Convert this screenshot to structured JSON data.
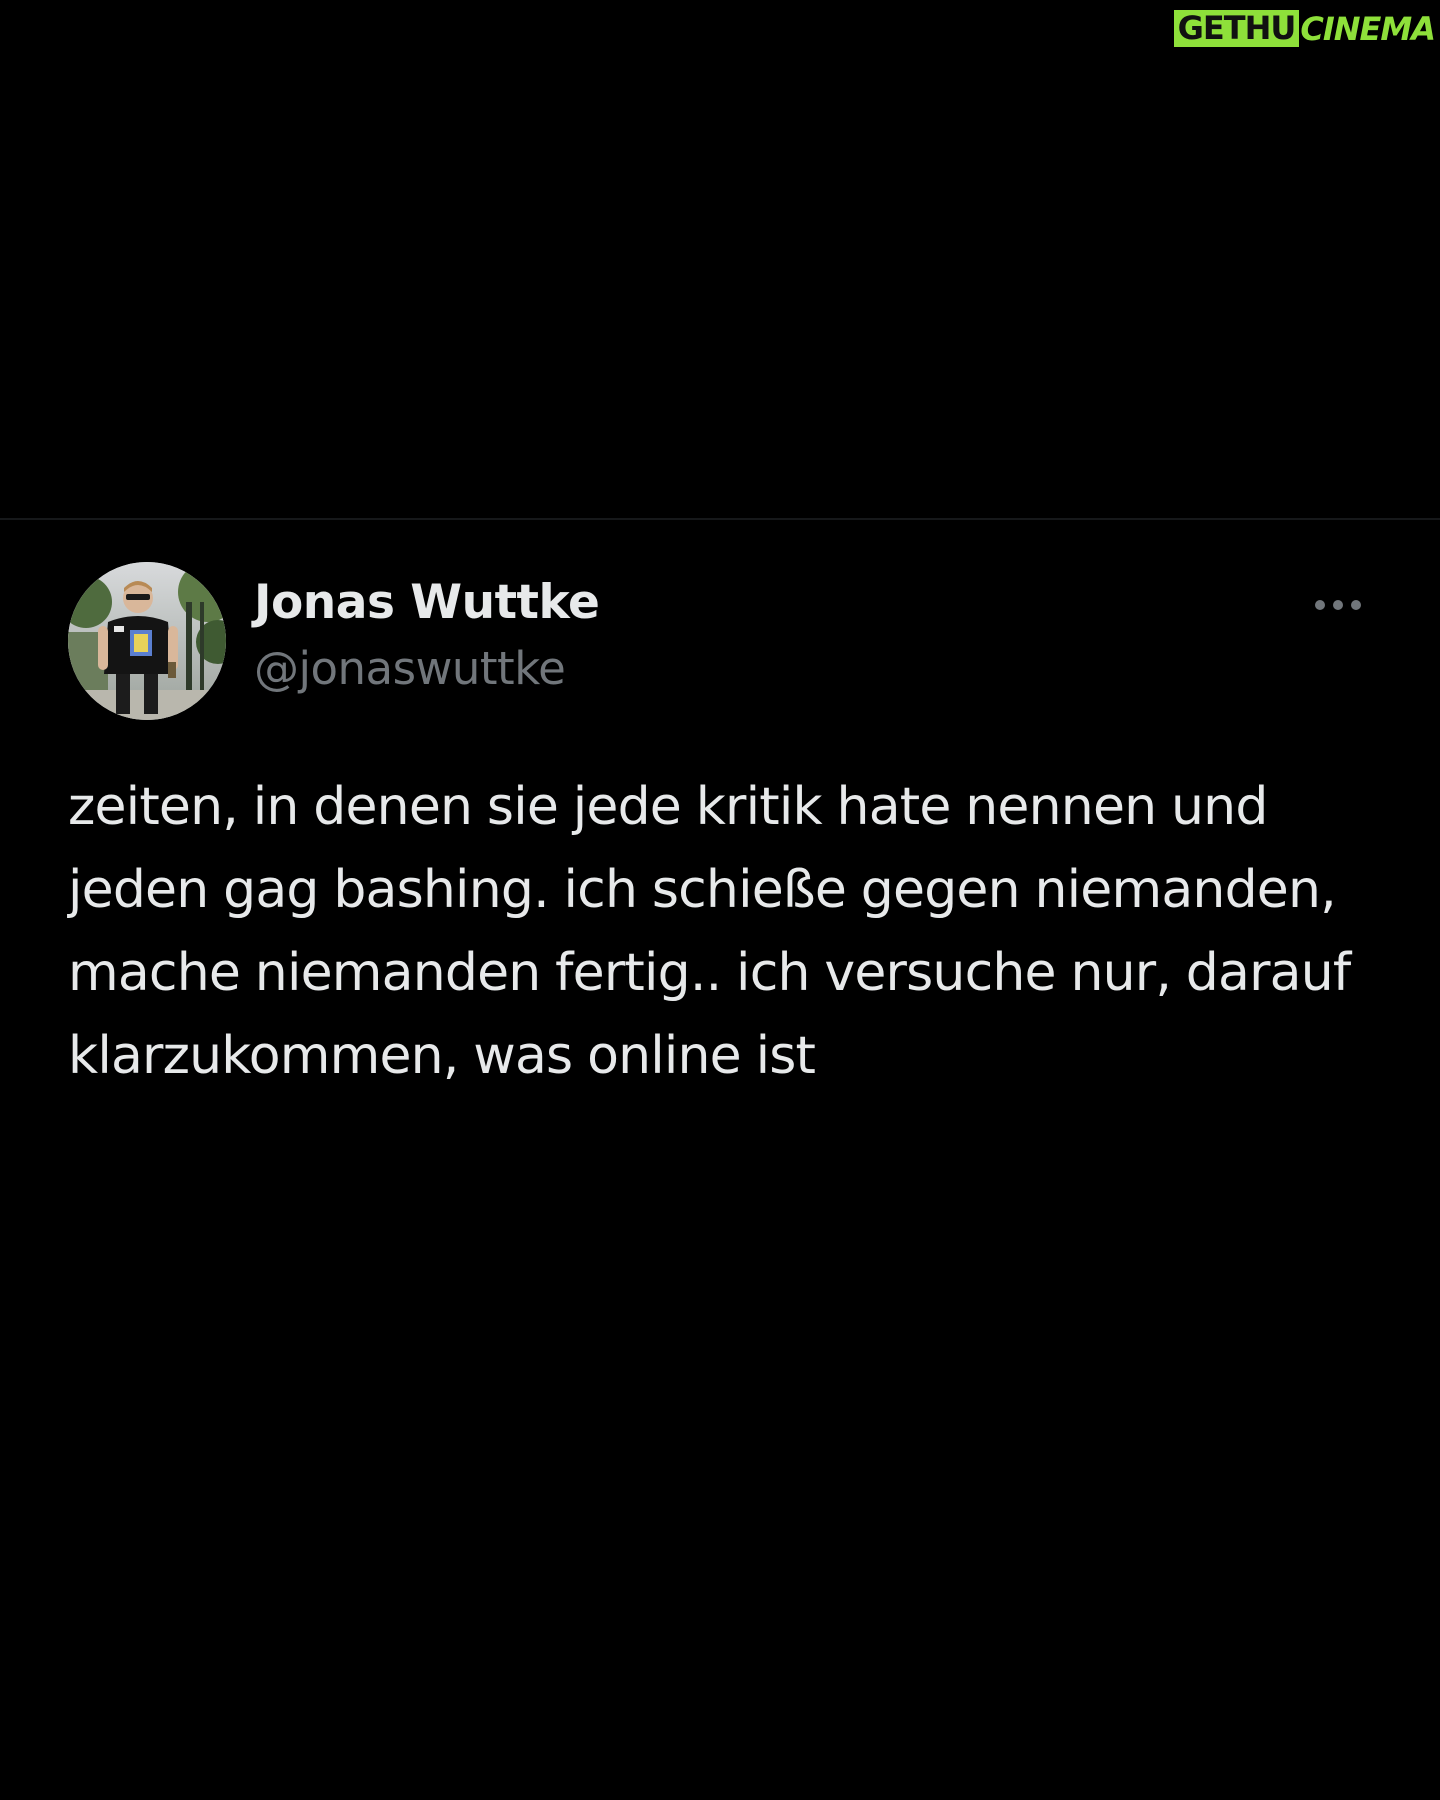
{
  "watermark": {
    "left": "GETHU",
    "right": "CINEMA",
    "accent_color": "#8ee03a"
  },
  "tweet": {
    "author": {
      "display_name": "Jonas Wuttke",
      "handle": "@jonaswuttke",
      "avatar": "profile-photo"
    },
    "more_icon": "more-horizontal-icon",
    "text": "zeiten, in denen sie jede kritik hate nennen und jeden gag bashing. ich schieße gegen niemanden, mache niemanden fertig.. ich versuche nur, darauf klarzukommen, was online ist"
  },
  "colors": {
    "background": "#000000",
    "text_primary": "#e7e9ea",
    "text_secondary": "#71767b",
    "divider": "#16181a"
  }
}
